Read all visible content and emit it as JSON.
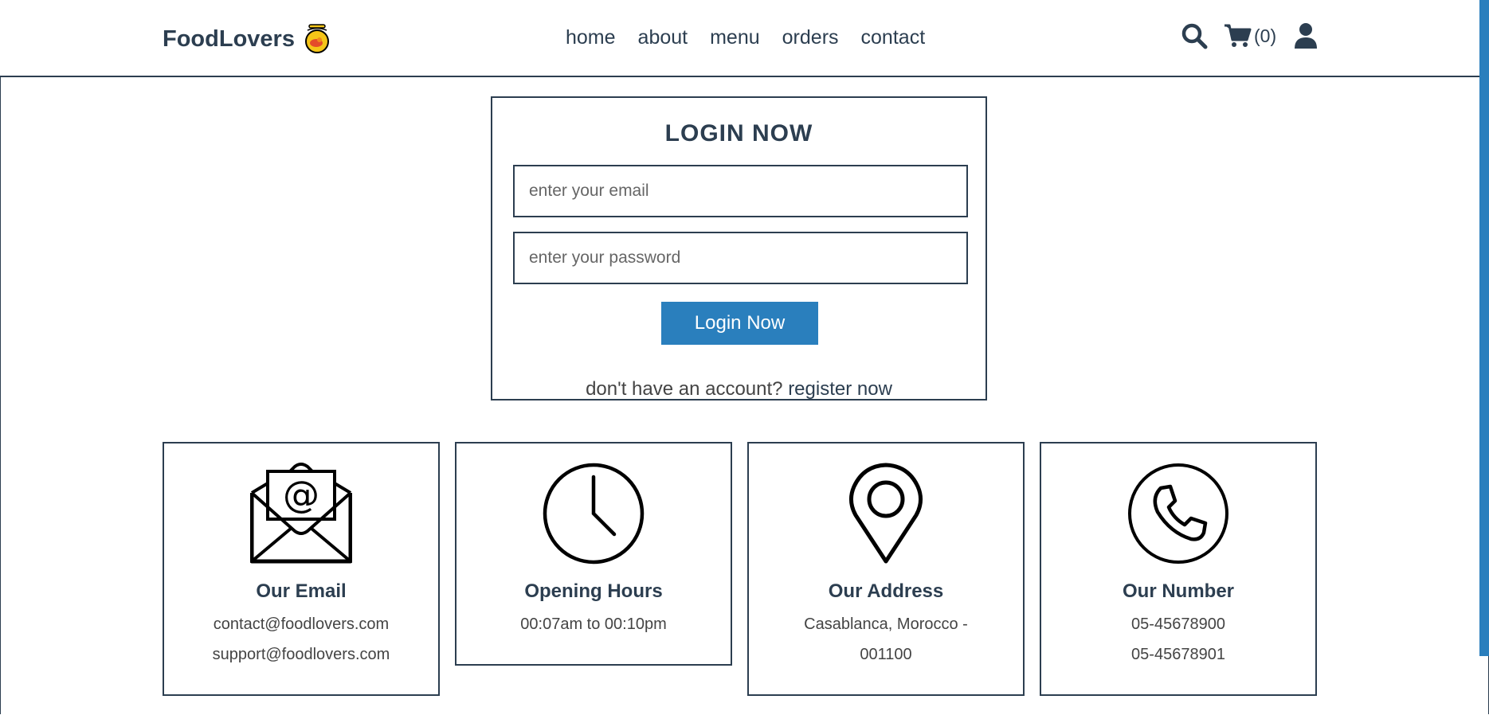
{
  "header": {
    "logo_text": "FoodLovers",
    "logo_icon": "food-bowl-icon",
    "nav": [
      {
        "label": "home"
      },
      {
        "label": "about"
      },
      {
        "label": "menu"
      },
      {
        "label": "orders"
      },
      {
        "label": "contact"
      }
    ],
    "icons": {
      "search": "search-icon",
      "cart": "cart-icon",
      "cart_count": "(0)",
      "user": "user-icon"
    }
  },
  "login": {
    "title": "LOGIN NOW",
    "email_placeholder": "enter your email",
    "password_placeholder": "enter your password",
    "button_label": "Login Now",
    "register_prompt": "don't have an account?",
    "register_link": "register now"
  },
  "info_cards": [
    {
      "icon": "envelope-icon",
      "title": "Our Email",
      "lines": [
        "contact@foodlovers.com",
        "support@foodlovers.com"
      ]
    },
    {
      "icon": "clock-icon",
      "title": "Opening Hours",
      "lines": [
        "00:07am to 00:10pm"
      ]
    },
    {
      "icon": "map-pin-icon",
      "title": "Our Address",
      "lines": [
        "Casablanca, Morocco -",
        "001100"
      ]
    },
    {
      "icon": "phone-icon",
      "title": "Our Number",
      "lines": [
        "05-45678900",
        "05-45678901"
      ]
    }
  ],
  "colors": {
    "primary_text": "#2c3e50",
    "accent": "#2a7fbd",
    "background": "#ffffff"
  }
}
